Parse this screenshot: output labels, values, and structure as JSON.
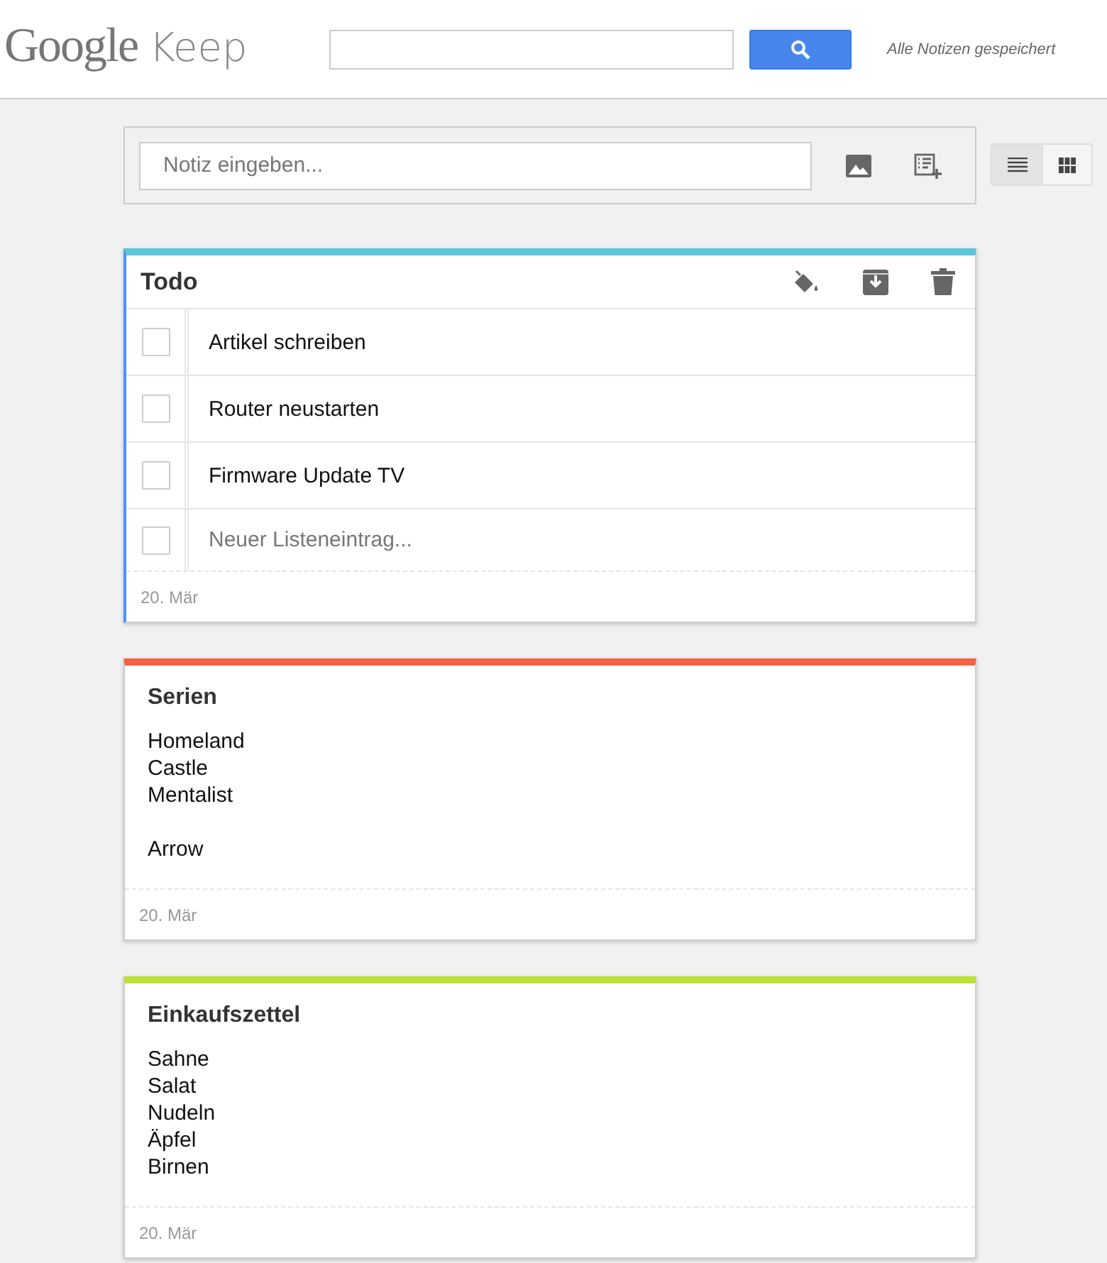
{
  "header": {
    "logo_google": "Google",
    "logo_keep": "Keep",
    "save_status": "Alle Notizen gespeichert"
  },
  "compose": {
    "placeholder": "Notiz eingeben..."
  },
  "view_toggle": [
    {
      "kind": "list",
      "selected": true
    },
    {
      "kind": "grid",
      "selected": false
    }
  ],
  "notes": [
    {
      "kind": "list",
      "title": "Todo",
      "color": "#5bc4d9",
      "focused": true,
      "items": [
        {
          "text": "Artikel schreiben",
          "checked": false
        },
        {
          "text": "Router neustarten",
          "checked": false
        },
        {
          "text": "Firmware Update TV",
          "checked": false
        }
      ],
      "new_item_placeholder": "Neuer Listeneintrag...",
      "new_item_checked": false,
      "date": "20. Mär"
    },
    {
      "kind": "text",
      "title": "Serien",
      "color": "#f66142",
      "focused": false,
      "paragraphs": [
        [
          "Homeland",
          "Castle",
          "Mentalist"
        ],
        [
          "Arrow"
        ]
      ],
      "date": "20. Mär"
    },
    {
      "kind": "text",
      "title": "Einkaufszettel",
      "color": "#bde135",
      "focused": false,
      "paragraphs": [
        [
          "Sahne",
          "Salat",
          "Nudeln",
          "Äpfel",
          "Birnen"
        ]
      ],
      "date": "20. Mär"
    }
  ]
}
